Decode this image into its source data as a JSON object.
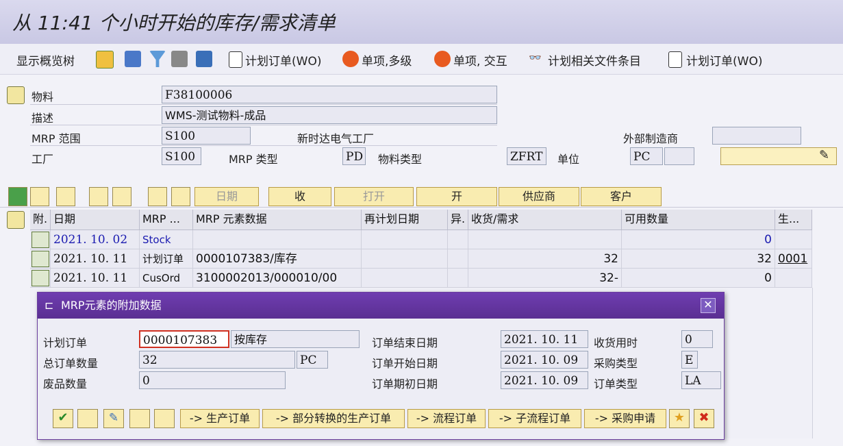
{
  "title": "从 11:41 个小时开始的库存/需求清单",
  "toolbar": {
    "show_tree": "显示概览树",
    "planned_order_1": "计划订单(WO)",
    "single_multi": "单项,多级",
    "single_interactive": "单项, 交互",
    "doc_items": "计划相关文件条目",
    "planned_order_2": "计划订单(WO)"
  },
  "header": {
    "material_label": "物料",
    "material_value": "F38100006",
    "desc_label": "描述",
    "desc_value": "WMS-测试物料-成品",
    "mrp_area_label": "MRP 范围",
    "mrp_area_value": "S100",
    "mrp_area_desc": "新时达电气工厂",
    "ext_mfr_label": "外部制造商",
    "ext_mfr_value": "",
    "plant_label": "工厂",
    "plant_value": "S100",
    "mrp_type_label": "MRP 类型",
    "mrp_type_value": "PD",
    "mat_type_label": "物料类型",
    "mat_type_value": "ZFRT",
    "unit_label": "单位",
    "unit_value": "PC"
  },
  "tabs": {
    "date": "日期",
    "receipt": "收",
    "open": "打开",
    "open2": "开",
    "vendor": "供应商",
    "customer": "客户"
  },
  "grid": {
    "columns": [
      "附.",
      "日期",
      "MRP ...",
      "MRP 元素数据",
      "再计划日期",
      "异.",
      "收货/需求",
      "可用数量",
      "生..."
    ],
    "rows": [
      {
        "date": "2021. 10. 02",
        "mrp": "Stock",
        "data": "",
        "reschedule": "",
        "exc": "",
        "qty": "",
        "avail": "0",
        "prod": ""
      },
      {
        "date": "2021. 10. 11",
        "mrp": "计划订单",
        "data": "0000107383/库存",
        "reschedule": "",
        "exc": "",
        "qty": "32",
        "avail": "32",
        "prod": "0001"
      },
      {
        "date": "2021. 10. 11",
        "mrp": "CusOrd",
        "data": "3100002013/000010/00",
        "reschedule": "",
        "exc": "",
        "qty": "32-",
        "avail": "0",
        "prod": ""
      }
    ]
  },
  "dialog": {
    "title": "MRP元素的附加数据",
    "po_label": "计划订单",
    "po_value": "0000107383",
    "po_desc": "按库存",
    "total_label": "总订单数量",
    "total_value": "32",
    "total_unit": "PC",
    "scrap_label": "废品数量",
    "scrap_value": "0",
    "end_label": "订单结束日期",
    "end_value": "2021. 10. 11",
    "start_label": "订单开始日期",
    "start_value": "2021. 10. 09",
    "opening_label": "订单期初日期",
    "opening_value": "2021. 10. 09",
    "gr_label": "收货用时",
    "gr_value": "0",
    "proc_label": "采购类型",
    "proc_value": "E",
    "otype_label": "订单类型",
    "otype_value": "LA",
    "btn_prod": "-> 生产订单",
    "btn_partial": "-> 部分转换的生产订单",
    "btn_process": "-> 流程订单",
    "btn_subprocess": "-> 子流程订单",
    "btn_preq": "-> 采购申请"
  },
  "colors": {
    "title_bg": "#cdcce6",
    "dialog_title": "#5e319a",
    "button_bg": "#f9ecb0",
    "date_blue": "#1a1ab0"
  }
}
